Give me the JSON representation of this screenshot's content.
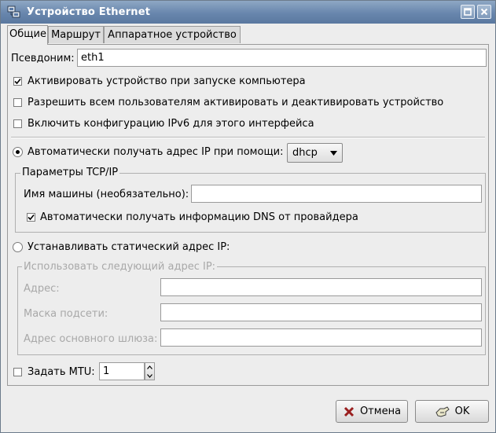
{
  "window": {
    "title": "Устройство Ethernet"
  },
  "tabs": [
    {
      "label": "Общие",
      "active": true
    },
    {
      "label": "Маршрут",
      "active": false
    },
    {
      "label": "Аппаратное устройство",
      "active": false
    }
  ],
  "nickname": {
    "label": "Псевдоним:",
    "value": "eth1"
  },
  "options": {
    "activate_on_boot": {
      "label": "Активировать устройство при запуске компьютера",
      "checked": true
    },
    "allow_all_users": {
      "label": "Разрешить всем пользователям активировать и деактивировать устройство",
      "checked": false
    },
    "enable_ipv6": {
      "label": "Включить конфигурацию IPv6 для этого интерфейса",
      "checked": false
    }
  },
  "auto_ip": {
    "label": "Автоматически получать адрес IP при помощи:",
    "selected": true,
    "method": "dhcp"
  },
  "tcpip": {
    "group_title": "Параметры TCP/IP",
    "hostname_label": "Имя машины (необязательно):",
    "hostname_value": "",
    "dns_label": "Автоматически получать информацию DNS от провайдера",
    "dns_checked": true
  },
  "static_ip": {
    "label": "Устанавливать статический адрес IP:",
    "selected": false,
    "group_title": "Использовать следующий адрес IP:",
    "address_label": "Адрес:",
    "netmask_label": "Маска подсети:",
    "gateway_label": "Адрес основного шлюза:"
  },
  "mtu": {
    "label": "Задать MTU:",
    "checked": false,
    "value": "1"
  },
  "buttons": {
    "cancel": "Отмена",
    "ok": "OK"
  },
  "colors": {
    "titlebar": "#6886ad",
    "window_bg": "#ededed",
    "disabled_text": "#a8a8a8"
  }
}
